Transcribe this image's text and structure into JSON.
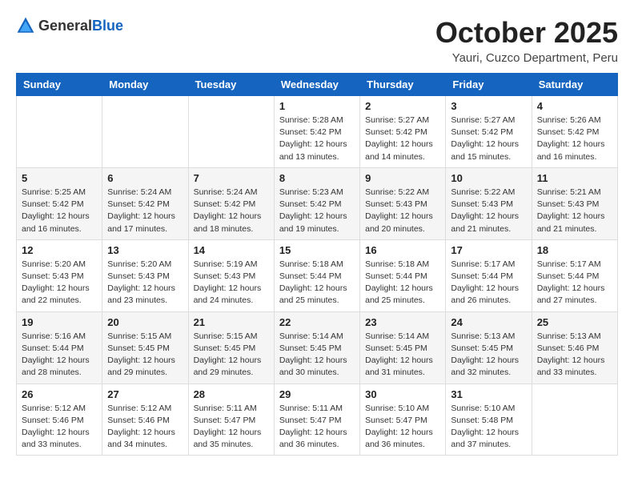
{
  "header": {
    "logo_general": "General",
    "logo_blue": "Blue",
    "month_title": "October 2025",
    "subtitle": "Yauri, Cuzco Department, Peru"
  },
  "days_of_week": [
    "Sunday",
    "Monday",
    "Tuesday",
    "Wednesday",
    "Thursday",
    "Friday",
    "Saturday"
  ],
  "weeks": [
    [
      {
        "day": "",
        "info": ""
      },
      {
        "day": "",
        "info": ""
      },
      {
        "day": "",
        "info": ""
      },
      {
        "day": "1",
        "info": "Sunrise: 5:28 AM\nSunset: 5:42 PM\nDaylight: 12 hours\nand 13 minutes."
      },
      {
        "day": "2",
        "info": "Sunrise: 5:27 AM\nSunset: 5:42 PM\nDaylight: 12 hours\nand 14 minutes."
      },
      {
        "day": "3",
        "info": "Sunrise: 5:27 AM\nSunset: 5:42 PM\nDaylight: 12 hours\nand 15 minutes."
      },
      {
        "day": "4",
        "info": "Sunrise: 5:26 AM\nSunset: 5:42 PM\nDaylight: 12 hours\nand 16 minutes."
      }
    ],
    [
      {
        "day": "5",
        "info": "Sunrise: 5:25 AM\nSunset: 5:42 PM\nDaylight: 12 hours\nand 16 minutes."
      },
      {
        "day": "6",
        "info": "Sunrise: 5:24 AM\nSunset: 5:42 PM\nDaylight: 12 hours\nand 17 minutes."
      },
      {
        "day": "7",
        "info": "Sunrise: 5:24 AM\nSunset: 5:42 PM\nDaylight: 12 hours\nand 18 minutes."
      },
      {
        "day": "8",
        "info": "Sunrise: 5:23 AM\nSunset: 5:42 PM\nDaylight: 12 hours\nand 19 minutes."
      },
      {
        "day": "9",
        "info": "Sunrise: 5:22 AM\nSunset: 5:43 PM\nDaylight: 12 hours\nand 20 minutes."
      },
      {
        "day": "10",
        "info": "Sunrise: 5:22 AM\nSunset: 5:43 PM\nDaylight: 12 hours\nand 21 minutes."
      },
      {
        "day": "11",
        "info": "Sunrise: 5:21 AM\nSunset: 5:43 PM\nDaylight: 12 hours\nand 21 minutes."
      }
    ],
    [
      {
        "day": "12",
        "info": "Sunrise: 5:20 AM\nSunset: 5:43 PM\nDaylight: 12 hours\nand 22 minutes."
      },
      {
        "day": "13",
        "info": "Sunrise: 5:20 AM\nSunset: 5:43 PM\nDaylight: 12 hours\nand 23 minutes."
      },
      {
        "day": "14",
        "info": "Sunrise: 5:19 AM\nSunset: 5:43 PM\nDaylight: 12 hours\nand 24 minutes."
      },
      {
        "day": "15",
        "info": "Sunrise: 5:18 AM\nSunset: 5:44 PM\nDaylight: 12 hours\nand 25 minutes."
      },
      {
        "day": "16",
        "info": "Sunrise: 5:18 AM\nSunset: 5:44 PM\nDaylight: 12 hours\nand 25 minutes."
      },
      {
        "day": "17",
        "info": "Sunrise: 5:17 AM\nSunset: 5:44 PM\nDaylight: 12 hours\nand 26 minutes."
      },
      {
        "day": "18",
        "info": "Sunrise: 5:17 AM\nSunset: 5:44 PM\nDaylight: 12 hours\nand 27 minutes."
      }
    ],
    [
      {
        "day": "19",
        "info": "Sunrise: 5:16 AM\nSunset: 5:44 PM\nDaylight: 12 hours\nand 28 minutes."
      },
      {
        "day": "20",
        "info": "Sunrise: 5:15 AM\nSunset: 5:45 PM\nDaylight: 12 hours\nand 29 minutes."
      },
      {
        "day": "21",
        "info": "Sunrise: 5:15 AM\nSunset: 5:45 PM\nDaylight: 12 hours\nand 29 minutes."
      },
      {
        "day": "22",
        "info": "Sunrise: 5:14 AM\nSunset: 5:45 PM\nDaylight: 12 hours\nand 30 minutes."
      },
      {
        "day": "23",
        "info": "Sunrise: 5:14 AM\nSunset: 5:45 PM\nDaylight: 12 hours\nand 31 minutes."
      },
      {
        "day": "24",
        "info": "Sunrise: 5:13 AM\nSunset: 5:45 PM\nDaylight: 12 hours\nand 32 minutes."
      },
      {
        "day": "25",
        "info": "Sunrise: 5:13 AM\nSunset: 5:46 PM\nDaylight: 12 hours\nand 33 minutes."
      }
    ],
    [
      {
        "day": "26",
        "info": "Sunrise: 5:12 AM\nSunset: 5:46 PM\nDaylight: 12 hours\nand 33 minutes."
      },
      {
        "day": "27",
        "info": "Sunrise: 5:12 AM\nSunset: 5:46 PM\nDaylight: 12 hours\nand 34 minutes."
      },
      {
        "day": "28",
        "info": "Sunrise: 5:11 AM\nSunset: 5:47 PM\nDaylight: 12 hours\nand 35 minutes."
      },
      {
        "day": "29",
        "info": "Sunrise: 5:11 AM\nSunset: 5:47 PM\nDaylight: 12 hours\nand 36 minutes."
      },
      {
        "day": "30",
        "info": "Sunrise: 5:10 AM\nSunset: 5:47 PM\nDaylight: 12 hours\nand 36 minutes."
      },
      {
        "day": "31",
        "info": "Sunrise: 5:10 AM\nSunset: 5:48 PM\nDaylight: 12 hours\nand 37 minutes."
      },
      {
        "day": "",
        "info": ""
      }
    ]
  ]
}
